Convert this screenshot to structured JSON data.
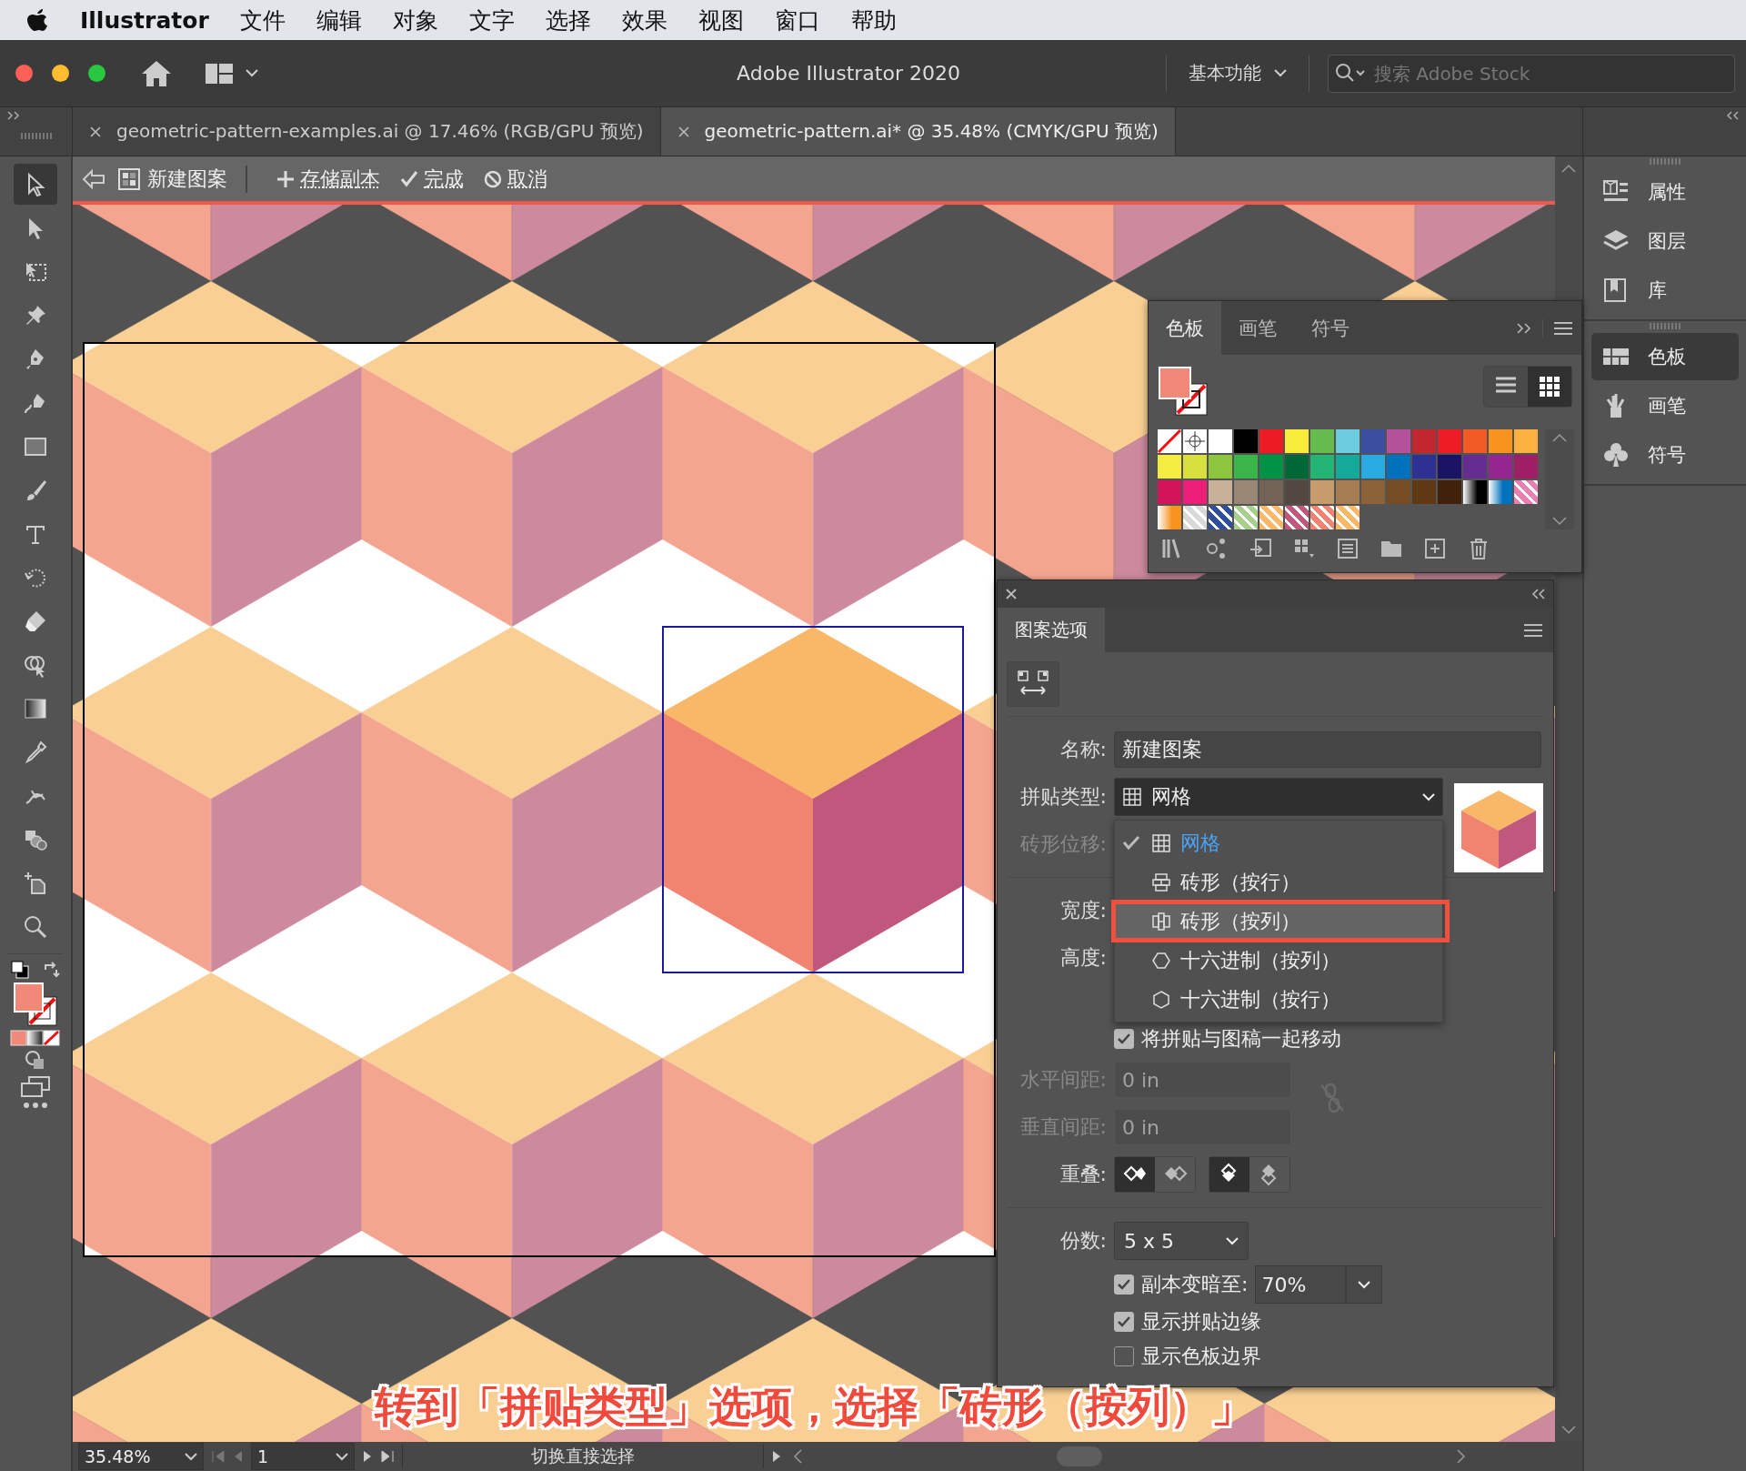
{
  "menu_bar": {
    "app_name": "Illustrator",
    "items": [
      "文件",
      "编辑",
      "对象",
      "文字",
      "选择",
      "效果",
      "视图",
      "窗口",
      "帮助"
    ]
  },
  "app_bar": {
    "title": "Adobe Illustrator 2020",
    "workspace": "基本功能",
    "search": {
      "placeholder": "搜索 Adobe Stock"
    }
  },
  "doc_tabs": [
    {
      "label": "geometric-pattern-examples.ai @ 17.46% (RGB/GPU 预览)",
      "selected": false
    },
    {
      "label": "geometric-pattern.ai* @ 35.48% (CMYK/GPU 预览)",
      "selected": true
    }
  ],
  "pattern_bar": {
    "name": "新建图案",
    "actions": [
      {
        "kind": "save",
        "label": "存储副本"
      },
      {
        "kind": "done",
        "label": "完成"
      },
      {
        "kind": "cancel",
        "label": "取消"
      }
    ]
  },
  "tools": [
    {
      "selected": true
    },
    {
      "selected": false
    },
    {
      "selected": false
    },
    {
      "selected": false
    },
    {
      "selected": false
    },
    {
      "selected": false
    },
    {
      "selected": false
    },
    {
      "selected": false
    },
    {
      "selected": false
    },
    {
      "selected": false
    },
    {
      "selected": false
    },
    {
      "selected": false
    },
    {
      "selected": false
    },
    {
      "selected": false
    },
    {
      "selected": false
    },
    {
      "selected": false
    },
    {
      "selected": false
    },
    {
      "selected": false
    }
  ],
  "swatches_panel": {
    "tabs": [
      {
        "label": "色板",
        "selected": true
      },
      {
        "label": "画笔",
        "selected": false
      },
      {
        "label": "符号",
        "selected": false
      }
    ],
    "view_buttons": [
      {
        "kind": "list",
        "selected": false
      },
      {
        "kind": "grid",
        "selected": true
      }
    ],
    "swatches": [
      {
        "kind": "none"
      },
      {
        "kind": "registration"
      },
      {
        "kind": "color",
        "color": "#ffffff"
      },
      {
        "kind": "color",
        "color": "#000000"
      },
      {
        "kind": "color",
        "color": "#ed1c24"
      },
      {
        "kind": "color",
        "color": "#f7ec3a"
      },
      {
        "kind": "color",
        "color": "#66bb4d"
      },
      {
        "kind": "color",
        "color": "#6dcde0"
      },
      {
        "kind": "color",
        "color": "#3a4fa0"
      },
      {
        "kind": "color",
        "color": "#b5519b"
      },
      {
        "kind": "color",
        "color": "#c1272d"
      },
      {
        "kind": "color",
        "color": "#ee1d25"
      },
      {
        "kind": "color",
        "color": "#f15a24"
      },
      {
        "kind": "color",
        "color": "#f7931e"
      },
      {
        "kind": "color",
        "color": "#fbb040"
      },
      {
        "kind": "color",
        "color": "#f5ec42"
      },
      {
        "kind": "color",
        "color": "#d7e03f"
      },
      {
        "kind": "color",
        "color": "#8cc63f"
      },
      {
        "kind": "color",
        "color": "#39b54a"
      },
      {
        "kind": "color",
        "color": "#009245"
      },
      {
        "kind": "color",
        "color": "#006837"
      },
      {
        "kind": "color",
        "color": "#22b573"
      },
      {
        "kind": "color",
        "color": "#15a99a"
      },
      {
        "kind": "color",
        "color": "#29abe2"
      },
      {
        "kind": "color",
        "color": "#0071bc"
      },
      {
        "kind": "color",
        "color": "#2e3192"
      },
      {
        "kind": "color",
        "color": "#1b1464"
      },
      {
        "kind": "color",
        "color": "#662d91"
      },
      {
        "kind": "color",
        "color": "#93278f"
      },
      {
        "kind": "color",
        "color": "#9e1f63"
      },
      {
        "kind": "color",
        "color": "#d4145a"
      },
      {
        "kind": "color",
        "color": "#ed1e79"
      },
      {
        "kind": "color",
        "color": "#c7b299"
      },
      {
        "kind": "color",
        "color": "#998675"
      },
      {
        "kind": "color",
        "color": "#736357"
      },
      {
        "kind": "color",
        "color": "#534741"
      },
      {
        "kind": "color",
        "color": "#c69c6d"
      },
      {
        "kind": "color",
        "color": "#a67c52"
      },
      {
        "kind": "color",
        "color": "#8c6239"
      },
      {
        "kind": "color",
        "color": "#754c24"
      },
      {
        "kind": "color",
        "color": "#603813"
      },
      {
        "kind": "color",
        "color": "#42210b"
      },
      {
        "kind": "gradient",
        "color": "#000000"
      },
      {
        "kind": "gradient",
        "color": "#0071bc"
      },
      {
        "kind": "pattern",
        "color": "#e87fb0"
      },
      {
        "kind": "gradient",
        "color": "#f7931e"
      },
      {
        "kind": "pattern",
        "color": "#d9d9d9"
      },
      {
        "kind": "pattern",
        "color": "#2e4f9e"
      },
      {
        "kind": "pattern",
        "color": "#a8d08d"
      },
      {
        "kind": "pattern",
        "color": "#fbb86a"
      },
      {
        "kind": "pattern",
        "color": "#c0587e"
      },
      {
        "kind": "pattern",
        "color": "#f08470"
      },
      {
        "kind": "pattern",
        "color": "#f9b768"
      }
    ]
  },
  "pattern_options": {
    "title": "图案选项",
    "name": {
      "label": "名称:",
      "value": "新建图案"
    },
    "tile_type": {
      "label": "拼贴类型:",
      "kind": "grid",
      "value": "网格"
    },
    "tile_type_options": [
      {
        "kind": "grid",
        "label": "网格",
        "checked": true,
        "highlighted": false
      },
      {
        "kind": "brick_row",
        "label": "砖形（按行）",
        "checked": false,
        "highlighted": false
      },
      {
        "kind": "brick_col",
        "label": "砖形（按列）",
        "checked": false,
        "highlighted": true
      },
      {
        "kind": "hex_col",
        "label": "十六进制（按列）",
        "checked": false,
        "highlighted": false
      },
      {
        "kind": "hex_row",
        "label": "十六进制（按行）",
        "checked": false,
        "highlighted": false
      }
    ],
    "brick_offset": {
      "label": "砖形位移:",
      "disabled": true
    },
    "width_label": "宽度:",
    "height_label": "高度:",
    "move_tile": {
      "label": "将拼贴与图稿一起移动",
      "checked": true
    },
    "h_spacing": {
      "label": "水平间距:",
      "value": "0 in",
      "disabled": true
    },
    "v_spacing": {
      "label": "垂直间距:",
      "value": "0 in",
      "disabled": true
    },
    "overlap_label": "重叠:",
    "overlap_h": [
      {
        "selected": true
      },
      {
        "selected": false
      }
    ],
    "overlap_v": [
      {
        "selected": true
      },
      {
        "selected": false
      }
    ],
    "copies": {
      "label": "份数:",
      "value": "5 x 5"
    },
    "dim_copies": {
      "label": "副本变暗至:",
      "checked": true,
      "value": "70%"
    },
    "show_tile_edge": {
      "label": "显示拼贴边缘",
      "checked": true
    },
    "show_swatch_bounds": {
      "label": "显示色板边界",
      "checked": false
    }
  },
  "dock_groups": [
    {
      "items": [
        {
          "kind": "properties",
          "label": "属性",
          "selected": false
        },
        {
          "kind": "layers",
          "label": "图层",
          "selected": false
        },
        {
          "kind": "libraries",
          "label": "库",
          "selected": false
        }
      ]
    },
    {
      "items": [
        {
          "kind": "swatches",
          "label": "色板",
          "selected": true
        },
        {
          "kind": "brushes",
          "label": "画笔",
          "selected": false
        },
        {
          "kind": "symbols",
          "label": "符号",
          "selected": false
        }
      ]
    }
  ],
  "status_bar": {
    "zoom": "35.48%",
    "page": "1",
    "status": "切换直接选择"
  },
  "caption": "转到「拼贴类型」选项，选择「砖形（按列）」"
}
